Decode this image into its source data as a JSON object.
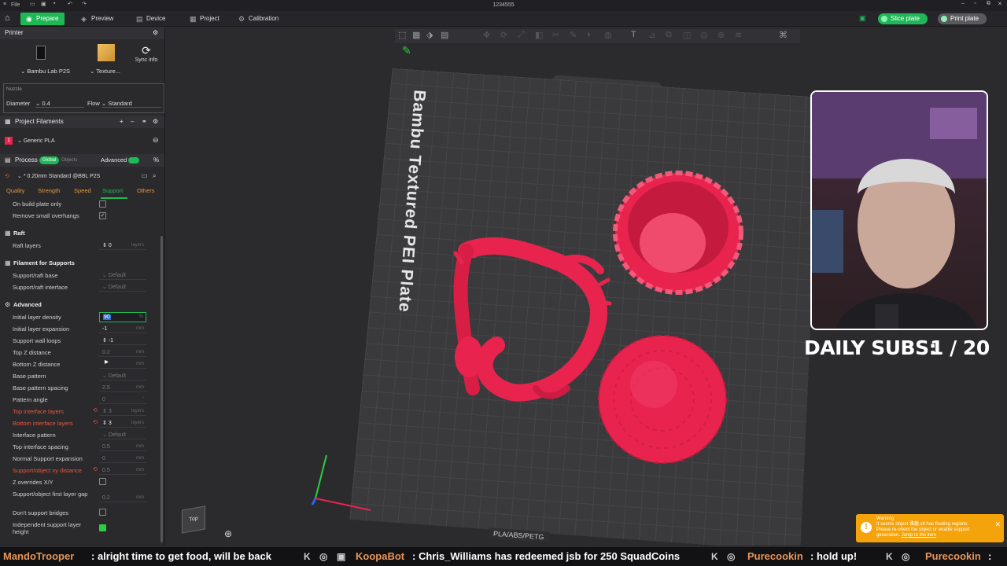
{
  "window": {
    "title": "1234555",
    "file_menu": "File"
  },
  "tabs": [
    {
      "label": "Prepare",
      "icon": "prepare-icon"
    },
    {
      "label": "Preview",
      "icon": "preview-icon"
    },
    {
      "label": "Device",
      "icon": "device-icon"
    },
    {
      "label": "Project",
      "icon": "project-icon"
    },
    {
      "label": "Calibration",
      "icon": "calibration-icon"
    }
  ],
  "actions": {
    "slice": "Slice plate",
    "print": "Print plate"
  },
  "printer": {
    "section": "Printer",
    "printer_name": "Bambu Lab P2S",
    "plate_type": "Texture...",
    "sync": "Sync info",
    "nozzle_label": "Nozzle",
    "diameter_label": "Diameter",
    "diameter_value": "0.4",
    "flow_label": "Flow",
    "flow_value": "Standard"
  },
  "filaments": {
    "section": "Project Filaments",
    "items": [
      {
        "index": "1",
        "name": "Generic PLA",
        "color": "#e8234e"
      }
    ]
  },
  "process": {
    "section": "Process",
    "global": "Global",
    "objects": "Objects",
    "advanced": "Advanced",
    "preset": "* 0.20mm Standard @BBL P2S",
    "tabs": [
      "Quality",
      "Strength",
      "Speed",
      "Support",
      "Others"
    ],
    "active_tab": "Support"
  },
  "settings": {
    "on_build_plate_only": "On build plate only",
    "remove_small_overhangs": "Remove small overhangs",
    "raft_group": "Raft",
    "raft_layers": "Raft layers",
    "raft_layers_value": "0",
    "layers_unit": "layers",
    "filament_group": "Filament for Supports",
    "support_raft_base": "Support/raft base",
    "support_raft_interface": "Support/raft interface",
    "default": "Default",
    "advanced_group": "Advanced",
    "initial_layer_density": "Initial layer density",
    "initial_layer_density_value": "90",
    "percent": "%",
    "initial_layer_expansion": "Initial layer expansion",
    "initial_layer_expansion_value": "-1",
    "mm": "mm",
    "support_wall_loops": "Support wall loops",
    "support_wall_loops_value": "-1",
    "top_z_distance": "Top Z distance",
    "top_z_value": "0.2",
    "bottom_z_distance": "Bottom Z distance",
    "base_pattern": "Base pattern",
    "base_pattern_spacing": "Base pattern spacing",
    "base_pattern_spacing_value": "2.5",
    "pattern_angle": "Pattern angle",
    "pattern_angle_value": "0",
    "top_interface_layers": "Top interface layers",
    "top_interface_layers_value": "3",
    "bottom_interface_layers": "Bottom interface layers",
    "bottom_interface_layers_value": "3",
    "interface_pattern": "Interface pattern",
    "top_interface_spacing": "Top interface spacing",
    "top_interface_spacing_value": "0.5",
    "normal_support_expansion": "Normal Support expansion",
    "normal_support_expansion_value": "0",
    "support_object_xy": "Support/object xy distance",
    "support_object_xy_value": "0.5",
    "z_overrides": "Z overrides X/Y",
    "first_layer_gap": "Support/object first layer gap",
    "first_layer_gap_value": "0.2",
    "dont_support_bridges": "Don't support bridges",
    "independent_height": "Independent support layer height"
  },
  "viewport": {
    "plate_label": "Bambu Textured PEI Plate",
    "plate_strip": "PLA/ABS/PETG",
    "view_cube": "Top",
    "model_color": "#e8234e"
  },
  "overlay": {
    "subs_label": "DAILY SUBS:",
    "subs_value": "1 / 20"
  },
  "toast": {
    "title": "Warning",
    "line1": "It seems object 雅龍.stl has floating regions.",
    "line2": "Please re-orient the object or enable support",
    "line3": "generation.",
    "link": "Jump to the item"
  },
  "ticker": [
    {
      "name": "MandoTrooper",
      "msg": ": alright time to get food, will be back"
    },
    {
      "name": "KoopaBot",
      "msg": ": Chris_Williams has redeemed jsb for 250 SquadCoins"
    },
    {
      "name": "Purecookin",
      "msg": ": hold up!"
    },
    {
      "name": "Purecookin",
      "msg": ""
    }
  ]
}
